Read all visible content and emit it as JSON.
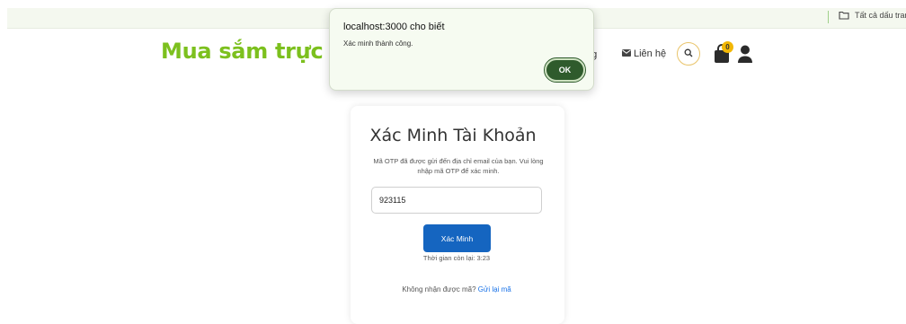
{
  "browser": {
    "bookmarks_folder_label": "Tất cả dấu trang"
  },
  "header": {
    "brand": "Mua sắm trực tuy",
    "nav_fragment": "ng",
    "contact_label": "Liên hệ",
    "cart_count": "0",
    "brand_color": "#7cc01e"
  },
  "alert": {
    "title": "localhost:3000 cho biết",
    "message": "Xác minh thành công.",
    "ok_label": "OK"
  },
  "verify": {
    "title": "Xác Minh Tài Khoản",
    "description": "Mã OTP đã được gửi đến địa chỉ email của bạn. Vui lòng nhập mã OTP để xác minh.",
    "otp_value": "923115",
    "button_label": "Xác Minh",
    "timer_text": "Thời gian còn lại: 3:23",
    "resend_prompt": "Không nhận được mã?",
    "resend_link": "Gửi lại mã",
    "button_color": "#1565c0"
  },
  "icons": [
    "folder-icon",
    "mail-icon",
    "search-icon",
    "cart-icon",
    "user-icon"
  ]
}
